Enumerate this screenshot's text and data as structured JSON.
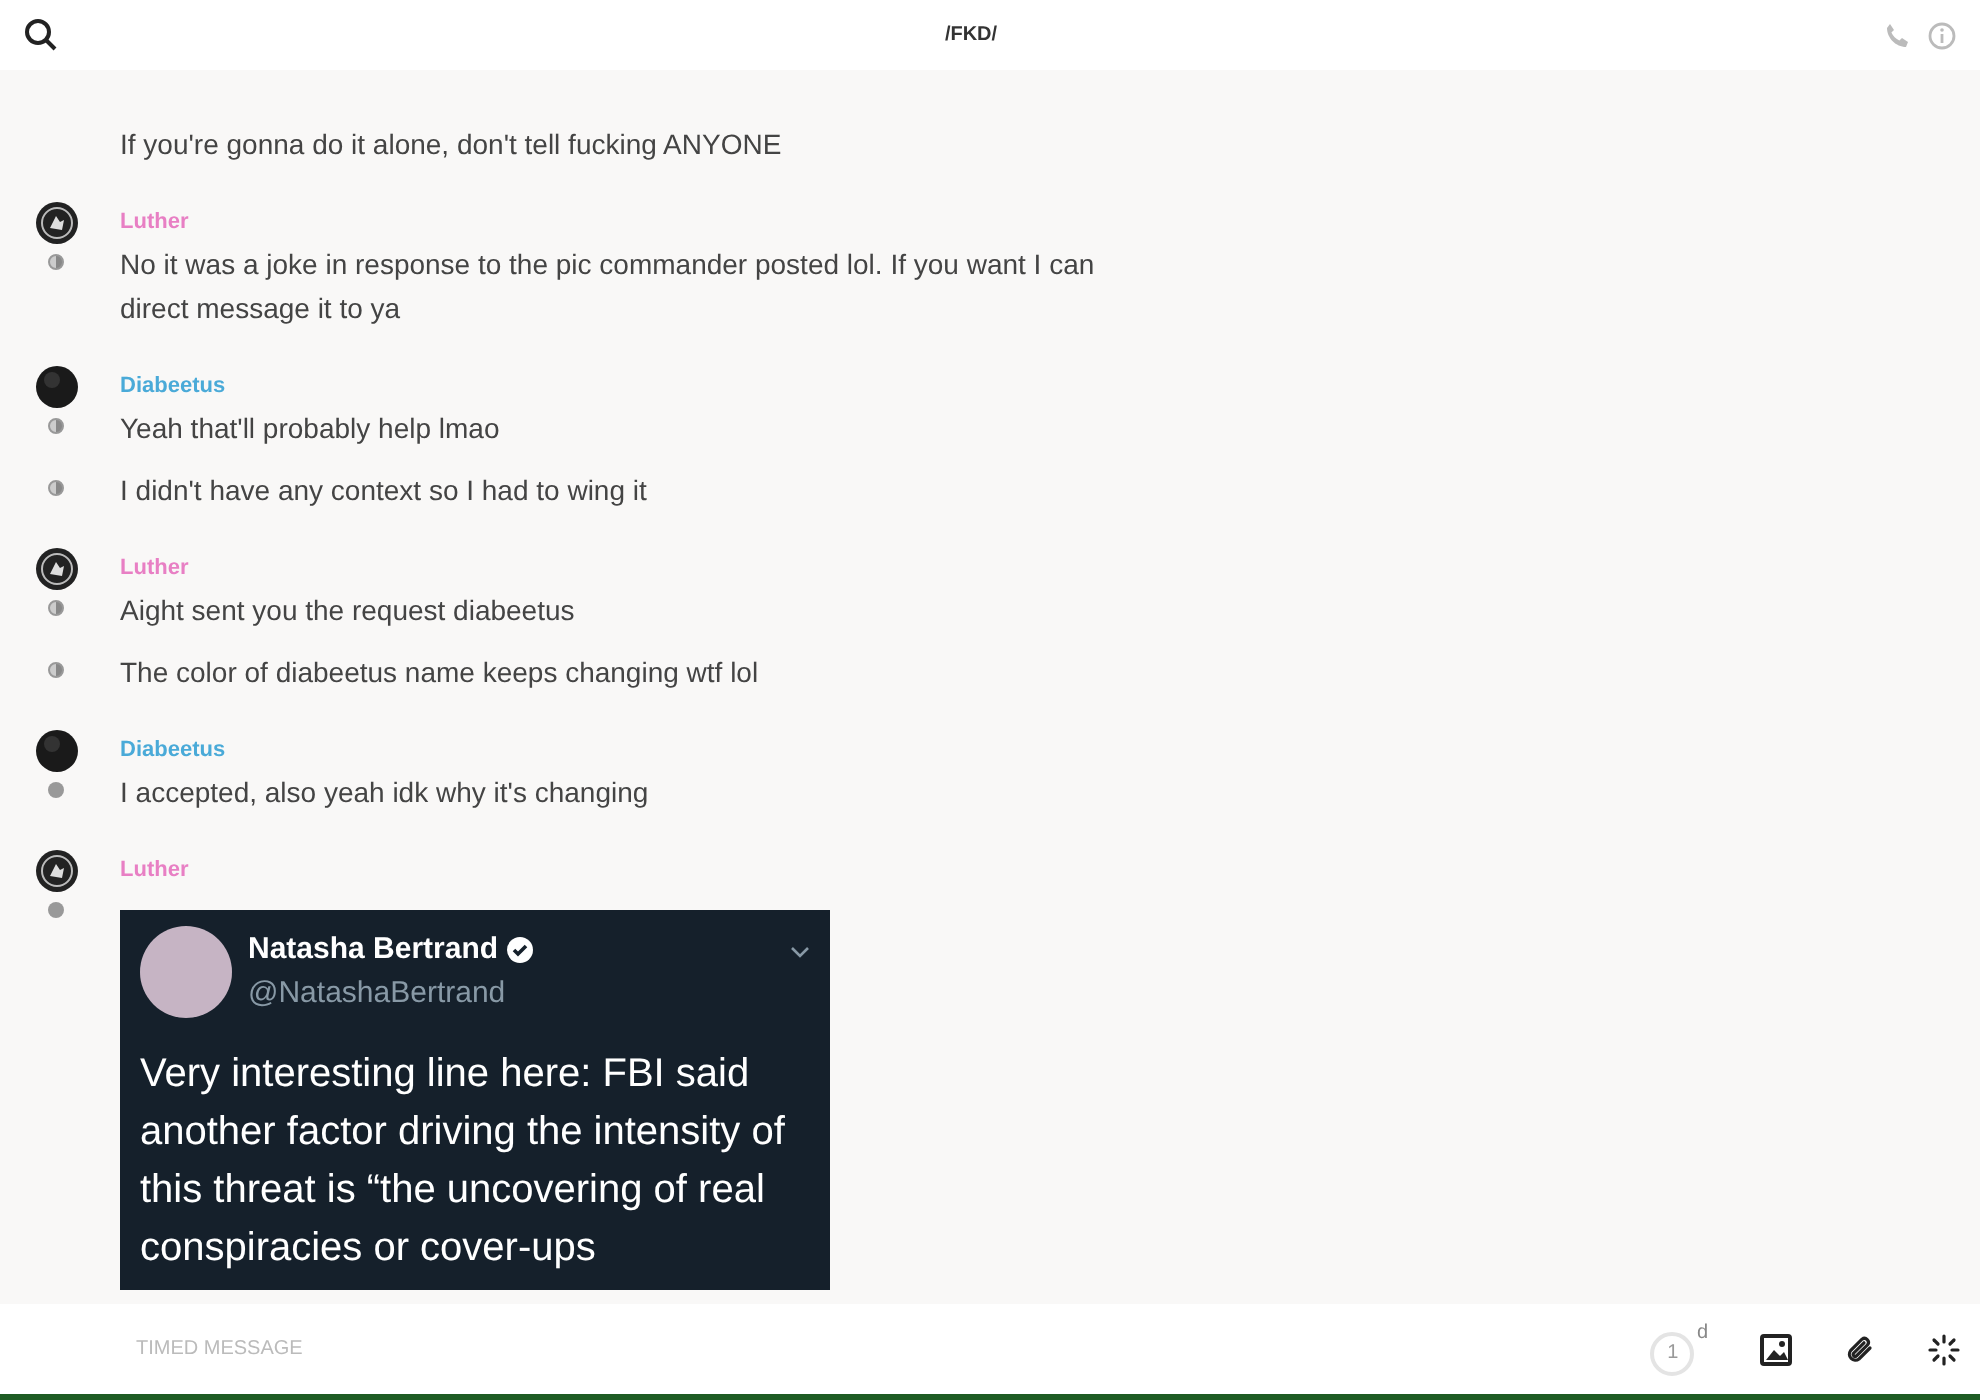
{
  "header": {
    "title": "/FKD/"
  },
  "groups": [
    {
      "messages": [
        {
          "kind": "text",
          "text": "If you're gonna do it alone, don't tell fucking ANYONE"
        }
      ]
    },
    {
      "author": "Luther",
      "color": "#e87fc4",
      "avatar": {
        "kind": "emblem"
      },
      "messages": [
        {
          "kind": "text",
          "text": "No it was a joke in response to the pic commander posted lol. If you want I can direct message it to ya",
          "read": true
        }
      ]
    },
    {
      "author": "Diabeetus",
      "color": "#4aaad8",
      "avatar": {
        "kind": "dark"
      },
      "messages": [
        {
          "kind": "text",
          "text": "Yeah that'll probably help lmao",
          "read": true
        },
        {
          "kind": "text",
          "text": "I didn't have any context so I had to wing it",
          "read": true
        }
      ]
    },
    {
      "author": "Luther",
      "color": "#e87fc4",
      "avatar": {
        "kind": "emblem"
      },
      "messages": [
        {
          "kind": "text",
          "text": "Aight sent you the request diabeetus",
          "read": true
        },
        {
          "kind": "text",
          "text": "The color of diabeetus name keeps changing wtf lol",
          "read": true
        }
      ]
    },
    {
      "author": "Diabeetus",
      "color": "#4aaad8",
      "avatar": {
        "kind": "dark"
      },
      "messages": [
        {
          "kind": "text",
          "text": "I accepted, also yeah idk why it's changing",
          "read": false
        }
      ]
    },
    {
      "author": "Luther",
      "color": "#e87fc4",
      "avatar": {
        "kind": "emblem"
      },
      "messages": [
        {
          "kind": "tweet",
          "read": false,
          "tweet": {
            "name": "Natasha Bertrand",
            "verified": true,
            "handle": "@NatashaBertrand",
            "text": "Very interesting line here: FBI said another factor driving the intensity of this threat is “the uncovering of real conspiracies or cover-ups"
          }
        }
      ]
    }
  ],
  "composer": {
    "placeholder": "TIMED MESSAGE",
    "timer": "1",
    "timer_unit": "d"
  }
}
